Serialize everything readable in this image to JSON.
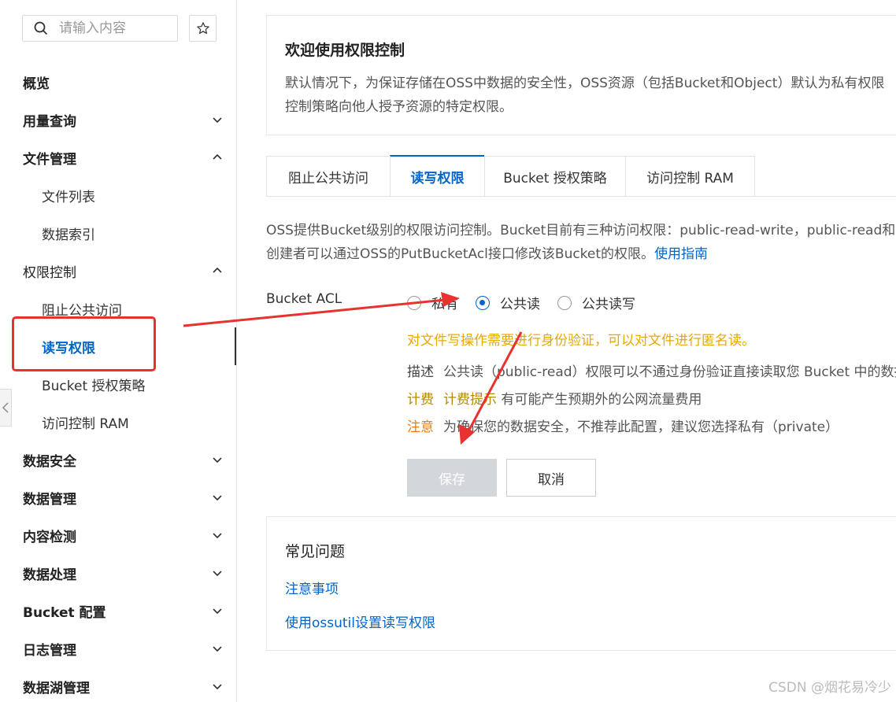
{
  "sidebar": {
    "search": {
      "placeholder": "请输入内容"
    },
    "star_icon": "star-icon",
    "items": [
      {
        "label": "概览",
        "level": "top",
        "chevron": ""
      },
      {
        "label": "用量查询",
        "level": "top",
        "chevron": "down"
      },
      {
        "label": "文件管理",
        "level": "top",
        "chevron": "up"
      },
      {
        "label": "文件列表",
        "level": "sub"
      },
      {
        "label": "数据索引",
        "level": "sub"
      },
      {
        "label": "权限控制",
        "level": "top",
        "chevron": "up"
      },
      {
        "label": "阻止公共访问",
        "level": "sub"
      },
      {
        "label": "读写权限",
        "level": "sub",
        "active": true
      },
      {
        "label": "Bucket 授权策略",
        "level": "sub"
      },
      {
        "label": "访问控制 RAM",
        "level": "sub"
      },
      {
        "label": "数据安全",
        "level": "top",
        "chevron": "down"
      },
      {
        "label": "数据管理",
        "level": "top",
        "chevron": "down"
      },
      {
        "label": "内容检测",
        "level": "top",
        "chevron": "down"
      },
      {
        "label": "数据处理",
        "level": "top",
        "chevron": "down"
      },
      {
        "label": "Bucket 配置",
        "level": "top",
        "chevron": "down"
      },
      {
        "label": "日志管理",
        "level": "top",
        "chevron": "down"
      },
      {
        "label": "数据湖管理",
        "level": "top",
        "chevron": "down"
      }
    ]
  },
  "welcome": {
    "title": "欢迎使用权限控制",
    "line1": "默认情况下，为保证存储在OSS中数据的安全性，OSS资源（包括Bucket和Object）默认为私有权限",
    "line2": "控制策略向他人授予资源的特定权限。"
  },
  "tabs": [
    {
      "label": "阻止公共访问"
    },
    {
      "label": "读写权限",
      "active": true
    },
    {
      "label": "Bucket 授权策略"
    },
    {
      "label": "访问控制 RAM"
    }
  ],
  "intro": {
    "line1": "OSS提供Bucket级别的权限访问控制。Bucket目前有三种访问权限：public-read-write，public-read和pr",
    "line2": "创建者可以通过OSS的PutBucketAcl接口修改该Bucket的权限。",
    "guide_link": "使用指南"
  },
  "acl": {
    "label": "Bucket ACL",
    "options": [
      "私有",
      "公共读",
      "公共读写"
    ],
    "selected": "公共读",
    "warning": "对文件写操作需要进行身份验证，可以对文件进行匿名读。",
    "desc_key": "描述",
    "desc_text": "公共读（public-read）权限可以不通过身份验证直接读取您 Bucket 中的数据",
    "fee_key": "计费",
    "fee_hint": "计费提示",
    "fee_text": "有可能产生预期外的公网流量费用",
    "note_key": "注意",
    "note_text": "为确保您的数据安全，不推荐此配置，建议您选择私有（private）"
  },
  "buttons": {
    "save": "保存",
    "cancel": "取消"
  },
  "faq": {
    "title": "常见问题",
    "links": [
      "注意事项",
      "使用ossutil设置读写权限"
    ]
  },
  "watermark": "CSDN @烟花易冷少",
  "colors": {
    "accent": "#0064c8",
    "annotation_red": "#e8322f",
    "warning": "#e9a800",
    "note": "#f07c00"
  }
}
